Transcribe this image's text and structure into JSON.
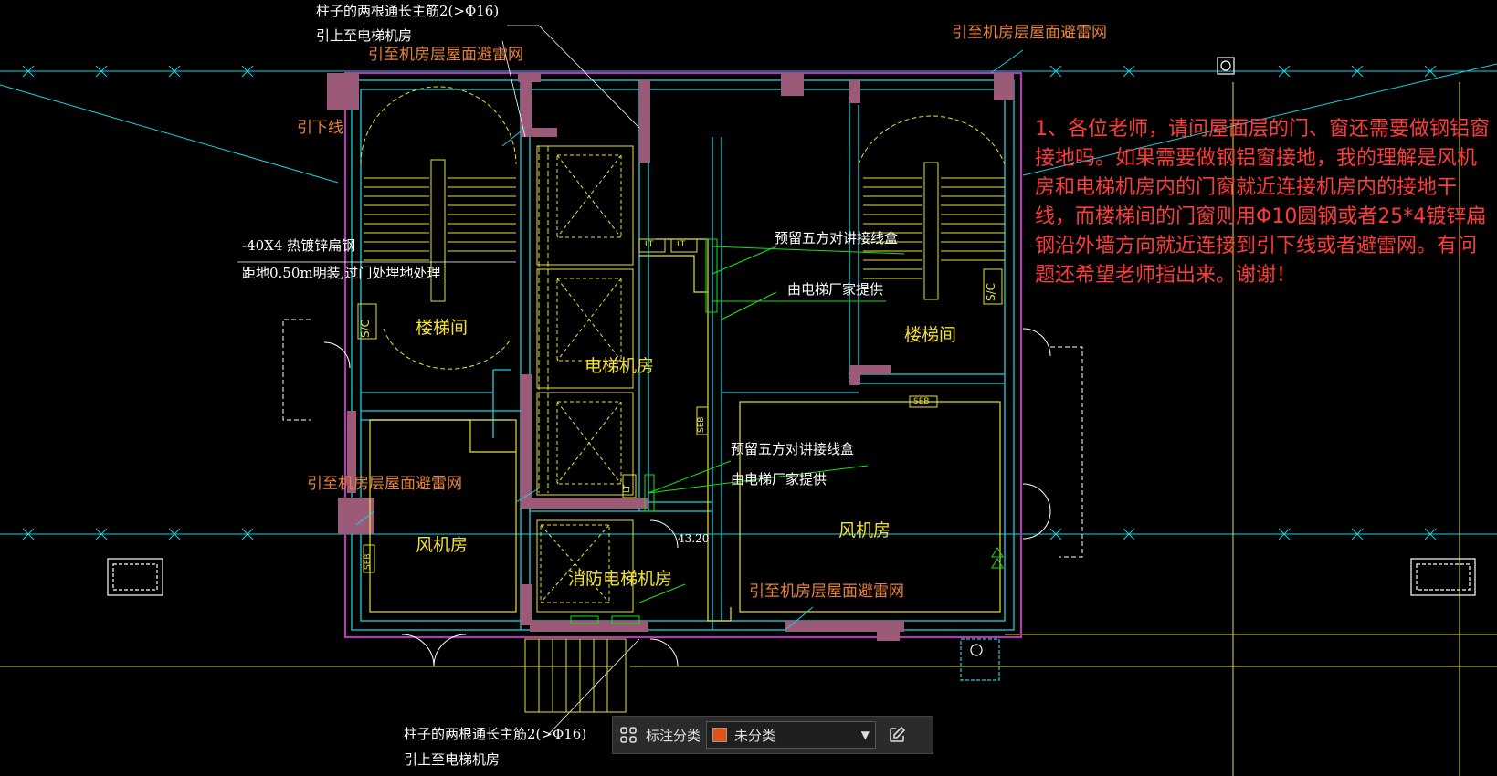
{
  "labels": {
    "roof_lightning_net_top_left": "引至机房层屋面避雷网",
    "roof_lightning_net_top_right": "引至机房层屋面避雷网",
    "roof_lightning_net_mid_left": "引至机房层屋面避雷网",
    "roof_lightning_net_mid_right": "引至机房层屋面避雷网",
    "down_conductor": "引下线",
    "stair_left": "楼梯间",
    "stair_right": "楼梯间",
    "elevator_room": "电梯机房",
    "fan_room_left": "风机房",
    "fan_room_right": "风机房",
    "fire_elevator_room": "消防电梯机房",
    "column_top_line1": "柱子的两根通长主筋2(>Φ16)",
    "column_top_line2": "引上至电梯机房",
    "column_bottom_line1": "柱子的两根通长主筋2(>Φ16)",
    "column_bottom_line2": "引上至电梯机房",
    "steel_line1": "-40X4 热镀锌扁钢",
    "steel_line2": "距地0.50m明装,过门处埋地处理",
    "intercom_box_1": "预留五方对讲接线盒",
    "supplied_by_1": "由电梯厂家提供",
    "intercom_box_2": "预留五方对讲接线盒",
    "supplied_by_2": "由电梯厂家提供",
    "elevation": "43.20",
    "sc_left": "S/C",
    "sc_right": "S/C",
    "seb_left": "SEB",
    "seb_mid": "SEB",
    "seb_right": "SEB",
    "lt_1": "LT",
    "lt_2": "LT",
    "lt_3": "LT"
  },
  "note": "1、各位老师，请问屋面层的门、窗还需要做钢铝窗接地吗。如果需要做钢铝窗接地，我的理解是风机房和电梯机房内的门窗就近连接机房内的接地干线，而楼梯间的门窗则用Φ10圆钢或者25*4镀锌扁钢沿外墙方向就近连接到引下线或者避雷网。有问题还希望老师指出来。谢谢！",
  "toolbar": {
    "annotate_label": "标注分类",
    "category_value": "未分类",
    "category_color": "#e0521a",
    "annotate_icon": "grid-icon",
    "edit_icon": "edit-icon"
  },
  "colors": {
    "background": "#000000",
    "wall_fill": "#9b5a78",
    "cyan_line": "#19d3e0",
    "yellow_line": "#e6e03a",
    "green_line": "#19e019",
    "magenta_outline": "#c030c0",
    "note_text": "#ff3b3b",
    "orange_text": "#e8823a"
  }
}
